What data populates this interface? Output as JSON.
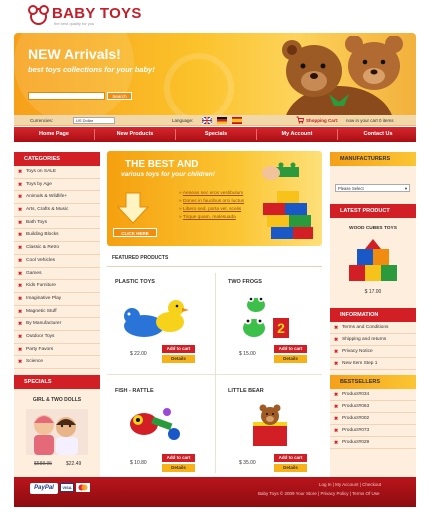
{
  "header": {
    "logo_title": "BABY TOYS",
    "logo_sub": "the best quality for you"
  },
  "banner": {
    "headline": "NEW Arrivals!",
    "tagline": "best toys collections for your baby!",
    "search_placeholder": "",
    "search_button": "Search"
  },
  "infobar": {
    "currencies_label": "Currencies:",
    "currency_value": "US Dollar",
    "language_label": "Language:",
    "cart_label": "Shopping Cart:",
    "cart_text": "now in your cart 0 items"
  },
  "nav": [
    "Home Page",
    "New Products",
    "Specials",
    "My Account",
    "Contact Us"
  ],
  "categories": {
    "title": "CATEGORIES",
    "items": [
      "Toys on SALE",
      "Toys by Age",
      "Animals & Wildlife+",
      "Arts, Crafts & Music",
      "Bath Toys",
      "Building Blocks",
      "Classic & Retro",
      "Cool Vehicles",
      "Games",
      "Kids Furniture",
      "Imaginative Play",
      "Magnetic Stuff",
      "By Manufacturer",
      "Outdoor Toys",
      "Party Favors",
      "Science"
    ]
  },
  "specials": {
    "title": "SPECIALS",
    "product": "GIRL & TWO DOLLS",
    "old_price": "$588.95",
    "new_price": "$22.49"
  },
  "promo": {
    "line1": "THE BEST AND",
    "line2": "various toys for your children!",
    "items": [
      "Aenean nec eros vestibulum",
      "Donec in faucibus orci luctus",
      "Libero sed, porta vel, scelis",
      "Tirque quam, malesuada"
    ],
    "button": "CLICK HERE"
  },
  "featured": {
    "title": "FEATURED PRODUCTS",
    "items": [
      {
        "name": "PLASTIC TOYS",
        "price": "$ 22.00",
        "add": "Add to cart",
        "details": "Details"
      },
      {
        "name": "TWO FROGS",
        "price": "$ 15.00",
        "add": "Add to cart",
        "details": "Details"
      },
      {
        "name": "FISH - RATTLE",
        "price": "$ 10.80",
        "add": "Add to cart",
        "details": "Details"
      },
      {
        "name": "LITTLE BEAR",
        "price": "$ 35.00",
        "add": "Add to cart",
        "details": "Details"
      }
    ]
  },
  "right": {
    "manufacturers_title": "MANUFACTURERS",
    "select_value": "Please Select",
    "latest_title": "LATEST PRODUCT",
    "latest_name": "WOOD CUBES TOYS",
    "latest_price": "$ 17.00",
    "info_title": "INFORMATION",
    "info_items": [
      "Terms and Conditions",
      "Shipping and returns",
      "Privacy Notice",
      "New Item Step 1"
    ],
    "best_title": "BESTSELLERS",
    "best_items": [
      "Product#034",
      "Product#063",
      "Product#002",
      "Product#073",
      "Product#029"
    ]
  },
  "footer": {
    "links": "Log In  |  My Account  |  Checkout",
    "copyright": "Baby Toys © 2009 Your Store  |  Privacy Policy  |  Terms Of Use",
    "payments": [
      "PayPal",
      "VISA",
      "MC"
    ]
  },
  "colors": {
    "red": "#d21f26",
    "orange": "#f7b21a",
    "cream": "#fdeede"
  }
}
